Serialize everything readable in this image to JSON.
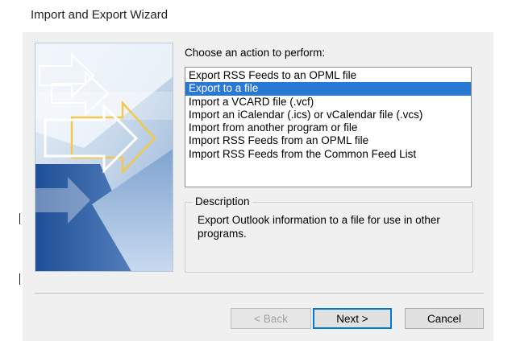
{
  "window": {
    "title": "Import and Export Wizard"
  },
  "prompt": "Choose an action to perform:",
  "actions": [
    {
      "label": "Export RSS Feeds to an OPML file",
      "selected": false
    },
    {
      "label": "Export to a file",
      "selected": true
    },
    {
      "label": "Import a VCARD file (.vcf)",
      "selected": false
    },
    {
      "label": "Import an iCalendar (.ics) or vCalendar file (.vcs)",
      "selected": false
    },
    {
      "label": "Import from another program or file",
      "selected": false
    },
    {
      "label": "Import RSS Feeds from an OPML file",
      "selected": false
    },
    {
      "label": "Import RSS Feeds from the Common Feed List",
      "selected": false
    }
  ],
  "description": {
    "legend": "Description",
    "text": "Export Outlook information to a file for use in other programs."
  },
  "buttons": {
    "back": "< Back",
    "next": "Next >",
    "cancel": "Cancel"
  },
  "colors": {
    "selection": "#2a78d6",
    "default_button_border": "#0078d7",
    "dialog_background": "#f0f0f0"
  },
  "icons": {
    "side_image": "import-export-arrows-graphic"
  }
}
